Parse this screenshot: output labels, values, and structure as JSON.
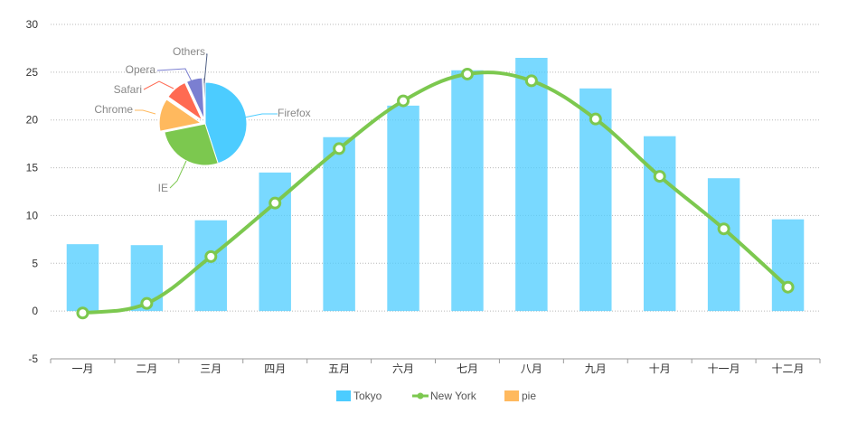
{
  "chart_data": {
    "type": "bar",
    "categories": [
      "一月",
      "二月",
      "三月",
      "四月",
      "五月",
      "六月",
      "七月",
      "八月",
      "九月",
      "十月",
      "十一月",
      "十二月"
    ],
    "series": [
      {
        "name": "Tokyo",
        "type": "bar",
        "color": "#4cccff",
        "values": [
          7.0,
          6.9,
          9.5,
          14.5,
          18.2,
          21.5,
          25.2,
          26.5,
          23.3,
          18.3,
          13.9,
          9.6
        ]
      },
      {
        "name": "New York",
        "type": "line",
        "color": "#7cc84f",
        "values": [
          -0.2,
          0.8,
          5.7,
          11.3,
          17.0,
          22.0,
          24.8,
          24.1,
          20.1,
          14.1,
          8.6,
          2.5
        ]
      }
    ],
    "pie": {
      "name": "pie",
      "legend_color": "#ffb95e",
      "slices": [
        {
          "label": "Firefox",
          "value": 45.0,
          "color": "#4cccff"
        },
        {
          "label": "IE",
          "value": 26.8,
          "color": "#7cc84f"
        },
        {
          "label": "Chrome",
          "value": 12.8,
          "color": "#ffb95e"
        },
        {
          "label": "Safari",
          "value": 8.5,
          "color": "#ff6a52"
        },
        {
          "label": "Opera",
          "value": 6.2,
          "color": "#7b7fd1"
        },
        {
          "label": "Others",
          "value": 0.7,
          "color": "#4f5f84"
        }
      ]
    },
    "ylim": [
      -5,
      30
    ],
    "yticks": [
      -5,
      0,
      5,
      10,
      15,
      20,
      25,
      30
    ],
    "grid": true,
    "legend": {
      "position": "bottom-center"
    }
  }
}
